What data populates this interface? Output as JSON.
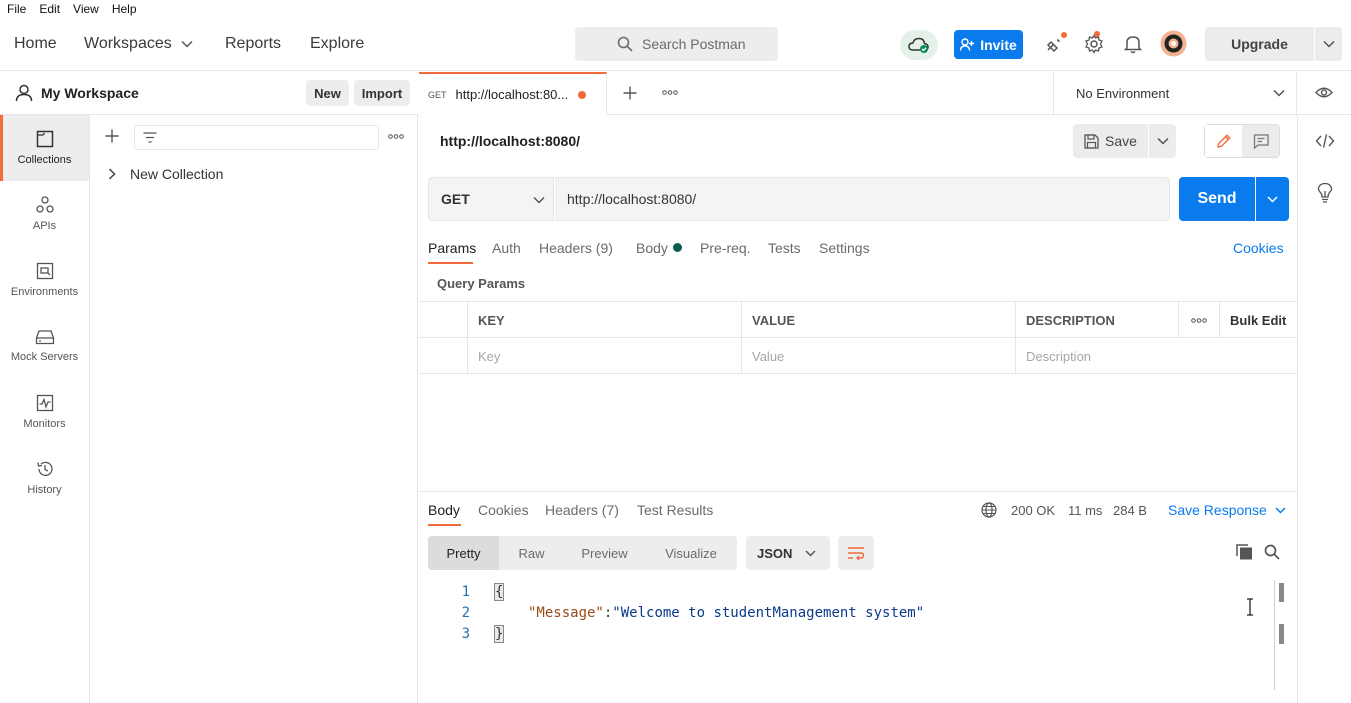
{
  "menubar": {
    "items": [
      "File",
      "Edit",
      "View",
      "Help"
    ]
  },
  "header": {
    "nav": [
      "Home",
      "Workspaces",
      "Reports",
      "Explore"
    ],
    "search_placeholder": "Search Postman",
    "invite_label": "Invite",
    "upgrade_label": "Upgrade"
  },
  "sidebar": {
    "workspace_title": "My Workspace",
    "new_label": "New",
    "import_label": "Import",
    "items": [
      {
        "label": "Collections",
        "icon": "collections-icon"
      },
      {
        "label": "APIs",
        "icon": "apis-icon"
      },
      {
        "label": "Environments",
        "icon": "environments-icon"
      },
      {
        "label": "Mock Servers",
        "icon": "mock-servers-icon"
      },
      {
        "label": "Monitors",
        "icon": "monitors-icon"
      },
      {
        "label": "History",
        "icon": "history-icon"
      }
    ],
    "collection_item": "New Collection"
  },
  "tabs": {
    "active_method": "GET",
    "active_url": "http://localhost:80...",
    "environment": "No Environment"
  },
  "request": {
    "title": "http://localhost:8080/",
    "save_label": "Save",
    "method": "GET",
    "url": "http://localhost:8080/",
    "send_label": "Send",
    "tabs": [
      "Params",
      "Auth",
      "Headers (9)",
      "Body",
      "Pre-req.",
      "Tests",
      "Settings"
    ],
    "cookies_label": "Cookies",
    "query_params_title": "Query Params",
    "table_headers": [
      "KEY",
      "VALUE",
      "DESCRIPTION"
    ],
    "bulk_edit_label": "Bulk Edit",
    "placeholders": [
      "Key",
      "Value",
      "Description"
    ]
  },
  "response": {
    "tabs": [
      "Body",
      "Cookies",
      "Headers (7)",
      "Test Results"
    ],
    "status": "200 OK",
    "time": "11 ms",
    "size": "284 B",
    "save_response_label": "Save Response",
    "formats": [
      "Pretty",
      "Raw",
      "Preview",
      "Visualize"
    ],
    "language": "JSON",
    "code": {
      "line_numbers": [
        "1",
        "2",
        "3"
      ],
      "open_brace": "{",
      "key": "\"Message\"",
      "colon": ": ",
      "value": "\"Welcome to studentManagement system\"",
      "close_brace": "}"
    }
  },
  "colors": {
    "accent": "#f26b3a",
    "primary": "#097bed",
    "status_dot": "#0d5c4f"
  }
}
